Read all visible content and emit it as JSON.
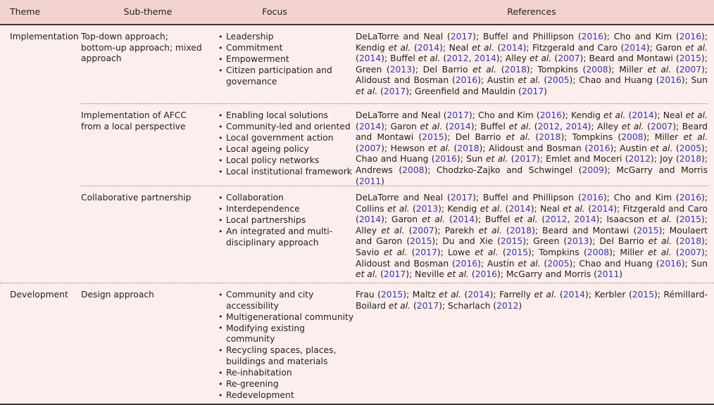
{
  "table": {
    "columns": [
      {
        "key": "theme",
        "label": "Theme"
      },
      {
        "key": "sub_theme",
        "label": "Sub-theme"
      },
      {
        "key": "focus",
        "label": "Focus"
      },
      {
        "key": "references",
        "label": "References"
      }
    ],
    "colors": {
      "header_background": "#f2d3d0",
      "body_background": "#fbeeed",
      "rule": "#3a3330",
      "text": "#231f1e",
      "citation_year": "#3838b4",
      "separator": "#8c7f7b"
    },
    "rows": [
      {
        "theme": "Implementation",
        "sub_theme": "Top-down approach; bottom-up approach; mixed approach",
        "focus": [
          "Leadership",
          "Commitment",
          "Empowerment",
          "Citizen participation and governance"
        ],
        "references": "DeLaTorre and Neal (2017); Buffel and Phillipson (2016); Cho and Kim (2016); Kendig et al. (2014); Neal et al. (2014); Fitzgerald and Caro (2014); Garon et al. (2014); Buffel et al. (2012, 2014); Alley et al. (2007); Beard and Montawi (2015); Green (2013); Del Barrio et al. (2018); Tompkins (2008); Miller et al. (2007); Alidoust and Bosman (2016); Austin et al. (2005); Chao and Huang (2016); Sun et al. (2017); Greenfield and Mauldin (2017)",
        "separator": "inset"
      },
      {
        "theme": "",
        "sub_theme": "Implementation of AFCC from a local perspective",
        "focus": [
          "Enabling local solutions",
          "Community-led and oriented",
          "Local government action",
          "Local ageing policy",
          "Local policy networks",
          "Local institutional framework"
        ],
        "references": "DeLaTorre and Neal (2017); Cho and Kim (2016); Kendig et al. (2014); Neal et al. (2014); Garon et al. (2014); Buffel et al. (2012, 2014); Alley et al. (2007); Beard and Montawi (2015); Del Barrio et al. (2018); Tompkins (2008); Miller et al. (2007); Hewson et al. (2018); Alidoust and Bosman (2016); Austin et al. (2005); Chao and Huang (2016); Sun et al. (2017); Emlet and Moceri (2012); Joy (2018); Andrews (2008); Chodzko-Zajko and Schwingel (2009); McGarry and Morris (2011)",
        "separator": "inset"
      },
      {
        "theme": "",
        "sub_theme": "Collaborative partnership",
        "focus": [
          "Collaboration",
          "Interdependence",
          "Local partnerships",
          "An integrated and multi-disciplinary approach"
        ],
        "references": "DeLaTorre and Neal (2017); Buffel and Phillipson (2016); Cho and Kim (2016); Collins et al. (2013); Kendig et al. (2014); Neal et al. (2014); Fitzgerald and Caro (2014); Garon et al. (2014); Buffel et al. (2012, 2014); Isaacson et al. (2015); Alley et al. (2007); Parekh et al. (2018); Beard and Montawi (2015); Moulaert and Garon (2015); Du and Xie (2015); Green (2013); Del Barrio et al. (2018); Savio et al. (2017); Lowe et al. (2015); Tompkins (2008); Miller et al. (2007); Alidoust and Bosman (2016); Austin et al. (2005); Chao and Huang (2016); Sun et al. (2017); Neville et al. (2016); McGarry and Morris (2011)",
        "separator": "full"
      },
      {
        "theme": "Development",
        "sub_theme": "Design approach",
        "focus": [
          "Community and city accessibility",
          "Multigenerational community",
          "Modifying existing community",
          "Recycling spaces, places, buildings and materials",
          "Re-inhabitation",
          "Re-greening",
          "Redevelopment"
        ],
        "references": "Frau (2015); Maltz et al. (2014); Farrelly et al. (2014); Kerbler (2015); Rémillard-Boilard et al. (2017); Scharlach (2012)",
        "separator": "none"
      }
    ]
  }
}
